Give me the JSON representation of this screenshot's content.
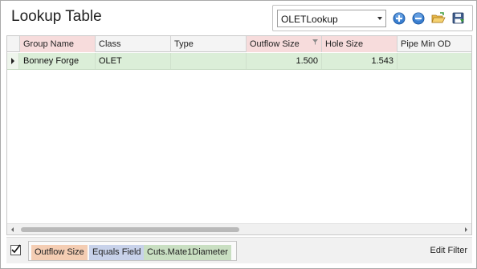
{
  "title": "Lookup Table",
  "toolbar": {
    "lookup_select": {
      "value": "OLETLookup"
    },
    "icons": [
      "add-icon",
      "remove-icon",
      "open-folder-icon",
      "save-icon"
    ]
  },
  "grid": {
    "columns": [
      "Group Name",
      "Class",
      "Type",
      "Outflow Size",
      "Hole Size",
      "Pipe Min OD"
    ],
    "rows": [
      {
        "group_name": "Bonney Forge",
        "class": "OLET",
        "type": "",
        "outflow_size": "1.500",
        "hole_size": "1.543",
        "pipe_min_od": ""
      }
    ]
  },
  "filter": {
    "field": "Outflow Size",
    "operator": "Equals Field",
    "value": "Cuts.Mate1Diameter",
    "edit_label": "Edit Filter"
  },
  "colors": {
    "row_highlight": "#dbeed8",
    "field_chip": "#f4cdb3",
    "operator_chip": "#c8d2ea",
    "value_chip": "#c9dfc2",
    "header_highlight": "#f7dcdc"
  }
}
